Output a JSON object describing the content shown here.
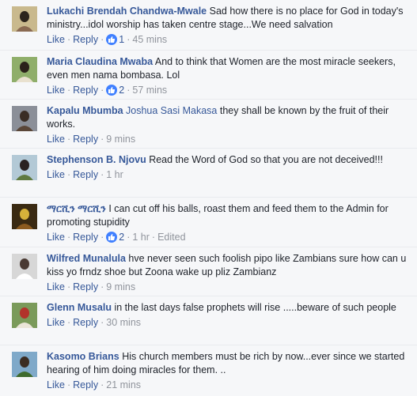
{
  "action_labels": {
    "like": "Like",
    "reply": "Reply",
    "separator": "·"
  },
  "comments": [
    {
      "author": "Lukachi Brendah Chandwa-Mwale",
      "text": "Sad how there is no place for God in today's ministry...idol worship has taken centre stage...We need salvation",
      "likes": "1",
      "time": "45 mins",
      "edited": "",
      "avatar_colors": [
        "#c9b98d",
        "#2c241c",
        "#8a6a52"
      ]
    },
    {
      "author": "Maria Claudina Mwaba",
      "text": "And to think that Women are the most miracle seekers, even men nama bombasa. Lol",
      "likes": "2",
      "time": "57 mins",
      "edited": "",
      "avatar_colors": [
        "#8fae6a",
        "#2b221a",
        "#e9e1cf"
      ]
    },
    {
      "author": "Kapalu Mbumba",
      "text": "Joshua Sasi Makasa they shall be known by the fruit of their works.",
      "tag": "Joshua Sasi Makasa",
      "likes": "",
      "time": "9 mins",
      "edited": "",
      "avatar_colors": [
        "#8b8f98",
        "#3a2d25",
        "#5a4638"
      ]
    },
    {
      "author": "Stephenson B. Njovu",
      "text": "Read the Word of God so that you are not deceived!!!",
      "likes": "",
      "time": "1 hr",
      "edited": "",
      "avatar_colors": [
        "#b3c9d6",
        "#2a2220",
        "#5f7a3f"
      ]
    },
    {
      "author": "ማርሺን ማርሺን",
      "text": "I can cut off his balls, roast them and feed them to the Admin for promoting stupidity",
      "likes": "2",
      "time": "1 hr",
      "edited": "Edited",
      "avatar_colors": [
        "#3a2a12",
        "#d6b13a",
        "#8c5b1f"
      ]
    },
    {
      "author": "Wilfred Munalula",
      "text": "hve never seen such foolish pipo like Zambians sure how can u kiss yo frndz shoe but Zoona wake up pliz Zambianz",
      "likes": "",
      "time": "9 mins",
      "edited": "",
      "avatar_colors": [
        "#d7d7d7",
        "#4a3a33",
        "#ffffff"
      ]
    },
    {
      "author": "Glenn Musalu",
      "text": "in the last days false prophets will rise .....beware of such people",
      "likes": "",
      "time": "30 mins",
      "edited": "",
      "avatar_colors": [
        "#7a9a5a",
        "#b2332b",
        "#eae5d8"
      ]
    },
    {
      "author": "Kasomo Brians",
      "text": "His church members must be rich by now...ever since we started hearing of him doing miracles for them. ..",
      "likes": "",
      "time": "21 mins",
      "edited": "",
      "avatar_colors": [
        "#7fa9c9",
        "#3b2c22",
        "#3f6b2e"
      ]
    }
  ]
}
